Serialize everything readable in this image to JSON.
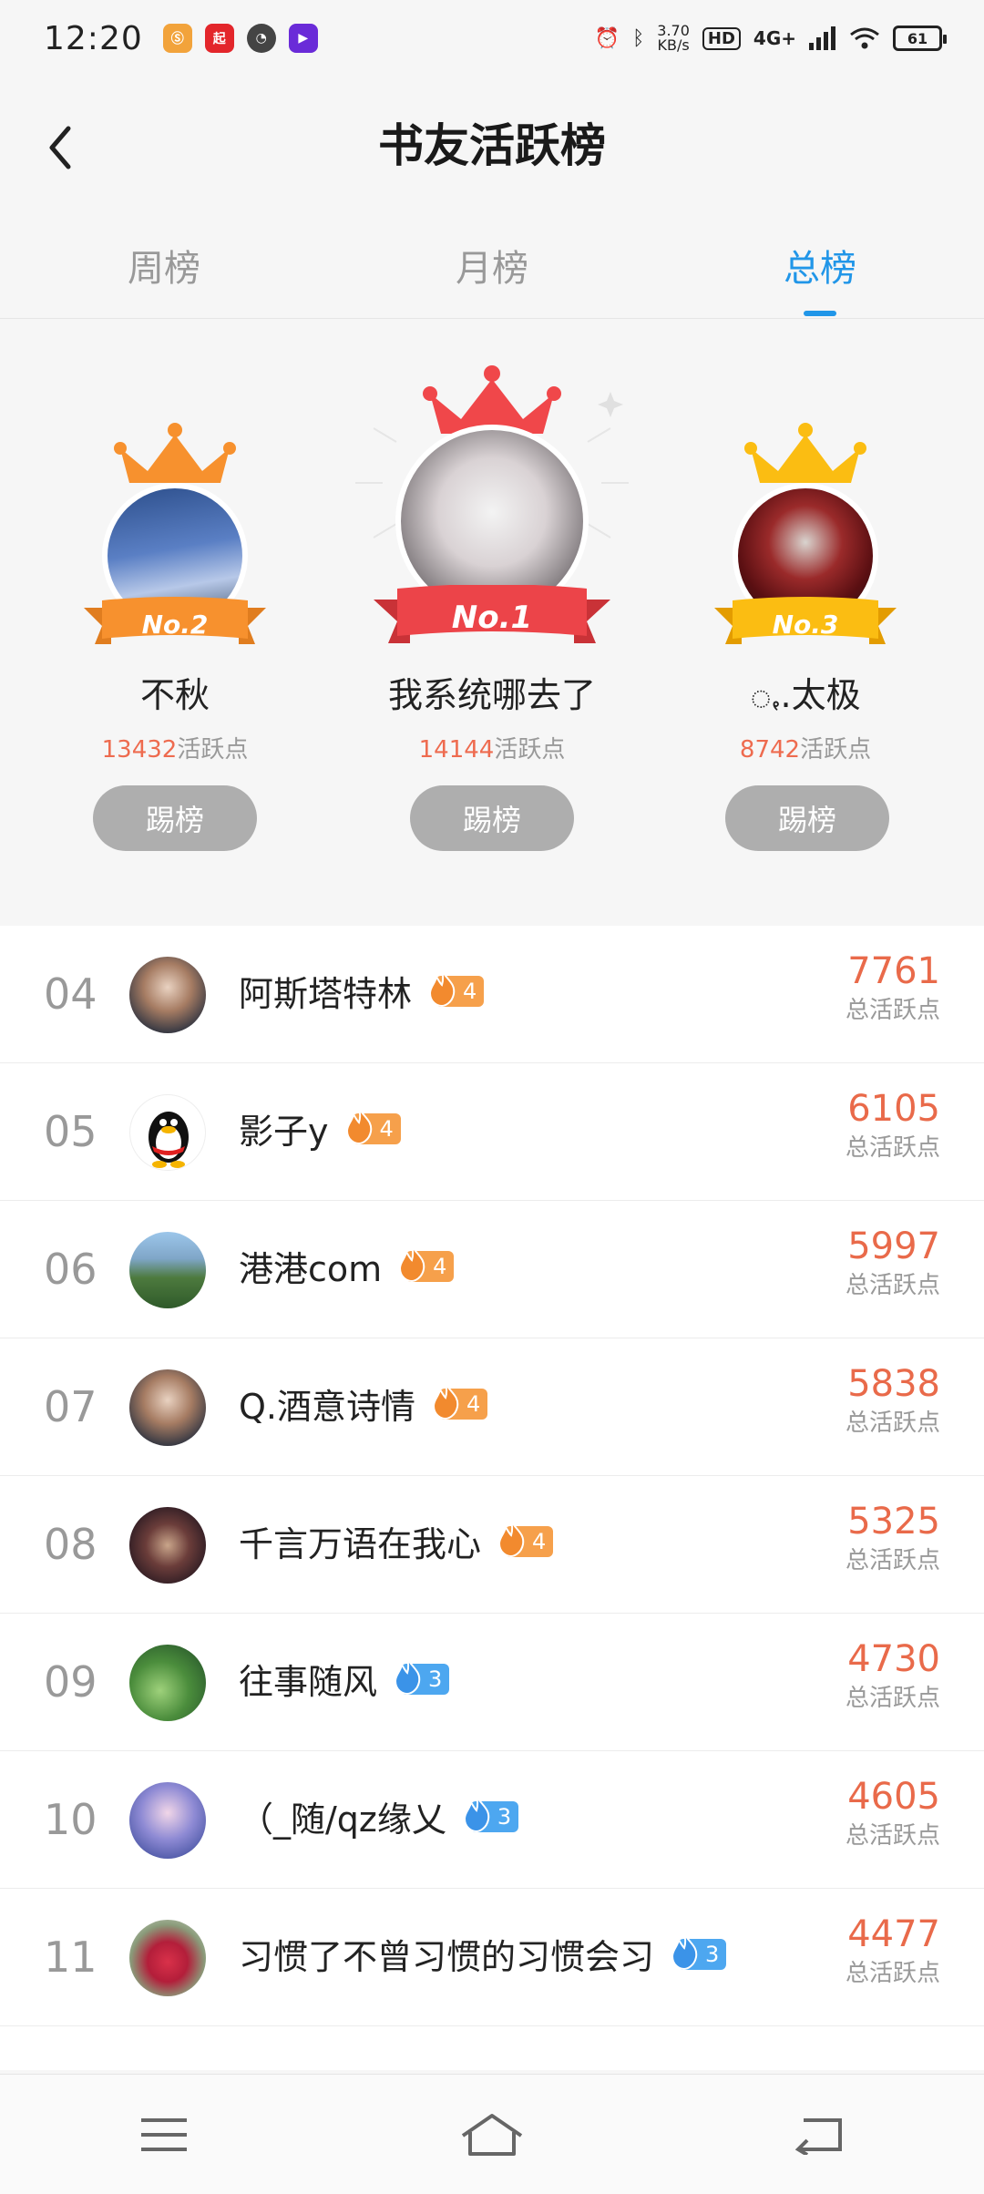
{
  "status": {
    "time": "12:20",
    "net_speed_value": "3.70",
    "net_speed_unit": "KB/s",
    "hd": "HD",
    "network": "4G+",
    "battery": "61"
  },
  "header": {
    "title": "书友活跃榜"
  },
  "tabs": [
    {
      "label": "周榜",
      "active": false
    },
    {
      "label": "月榜",
      "active": false
    },
    {
      "label": "总榜",
      "active": true
    }
  ],
  "podium": {
    "first": {
      "rank_label": "No.1",
      "name": "我系统哪去了",
      "points": "14144",
      "points_suffix": "活跃点",
      "button": "踢榜"
    },
    "second": {
      "rank_label": "No.2",
      "name": "不秋",
      "points": "13432",
      "points_suffix": "活跃点",
      "button": "踢榜"
    },
    "third": {
      "rank_label": "No.3",
      "name": "ꩻ.太极",
      "points": "8742",
      "points_suffix": "活跃点",
      "button": "踢榜"
    }
  },
  "list": {
    "points_label": "总活跃点",
    "rows": [
      {
        "rank": "04",
        "name": "阿斯塔特林",
        "level": "4",
        "level_color": "orange",
        "points": "7761",
        "avatar": "person"
      },
      {
        "rank": "05",
        "name": "影子y",
        "level": "4",
        "level_color": "orange",
        "points": "6105",
        "avatar": "penguin"
      },
      {
        "rank": "06",
        "name": "港港com",
        "level": "4",
        "level_color": "orange",
        "points": "5997",
        "avatar": "landscape"
      },
      {
        "rank": "07",
        "name": "Q.酒意诗情",
        "level": "4",
        "level_color": "orange",
        "points": "5838",
        "avatar": "person"
      },
      {
        "rank": "08",
        "name": "千言万语在我心",
        "level": "4",
        "level_color": "orange",
        "points": "5325",
        "avatar": "dark"
      },
      {
        "rank": "09",
        "name": "往事随风",
        "level": "3",
        "level_color": "blue",
        "points": "4730",
        "avatar": "leaf"
      },
      {
        "rank": "10",
        "name": "（_随/qz缘乂",
        "level": "3",
        "level_color": "blue",
        "points": "4605",
        "avatar": "anime"
      },
      {
        "rank": "11",
        "name": "习惯了不曾习惯的习惯会习",
        "level": "3",
        "level_color": "blue",
        "points": "4477",
        "avatar": "flower"
      }
    ]
  },
  "colors": {
    "accent": "#2196e8",
    "points": "#e96a4a",
    "level_orange": "#f6a04b",
    "level_blue": "#4da7f0",
    "kick_button": "#aeaeae"
  },
  "icons": {
    "back": "chevron-left-icon",
    "menu": "menu-icon",
    "home": "home-icon",
    "return": "return-icon"
  }
}
